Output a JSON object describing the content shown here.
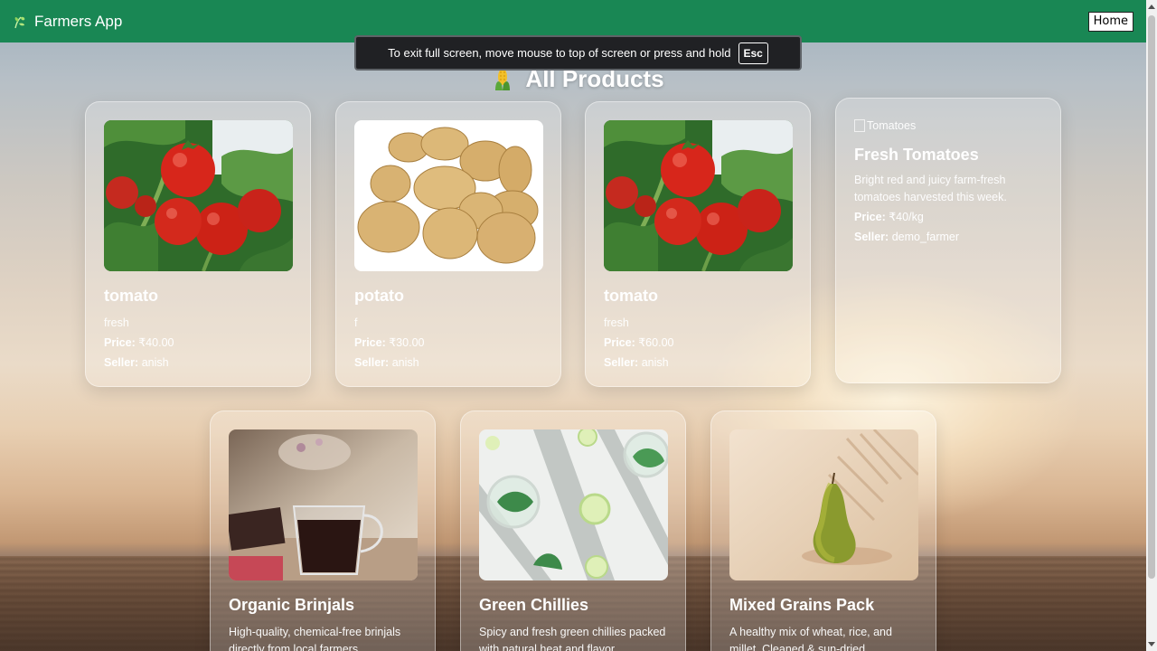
{
  "navbar": {
    "brand": "Farmers App",
    "brand_icon": "leaf-icon",
    "home_label": "Home",
    "bg_color": "#198754"
  },
  "toast": {
    "message": "To exit full screen, move mouse to top of screen or press and hold",
    "key": "Esc"
  },
  "page": {
    "title": "All Products",
    "title_icon": "corn-icon"
  },
  "labels": {
    "price": "Price:",
    "seller": "Seller:"
  },
  "products": [
    {
      "name": "tomato",
      "desc": "fresh",
      "price": "₹40.00",
      "seller": "anish",
      "image": "tomato-photo"
    },
    {
      "name": "potato",
      "desc": "f",
      "price": "₹30.00",
      "seller": "anish",
      "image": "potato-photo"
    },
    {
      "name": "tomato",
      "desc": "fresh",
      "price": "₹60.00",
      "seller": "anish",
      "image": "tomato-photo"
    },
    {
      "name": "Fresh Tomatoes",
      "desc": "Bright red and juicy farm-fresh tomatoes harvested this week.",
      "price": "₹40/kg",
      "seller": "demo_farmer",
      "image_alt": "Tomatoes"
    },
    {
      "name": "Organic Brinjals",
      "desc": "High-quality, chemical-free brinjals directly from local farmers.",
      "image": "tea-cup-photo"
    },
    {
      "name": "Green Chillies",
      "desc": "Spicy and fresh green chillies packed with natural heat and flavor.",
      "image": "lime-drinks-photo"
    },
    {
      "name": "Mixed Grains Pack",
      "desc": "A healthy mix of wheat, rice, and millet. Cleaned & sun-dried.",
      "image": "pear-photo"
    }
  ]
}
